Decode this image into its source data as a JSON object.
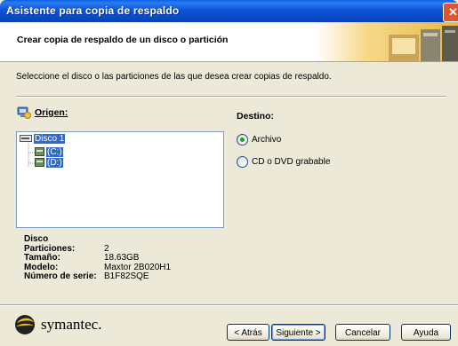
{
  "window": {
    "title": "Asistente para copia de respaldo",
    "close_glyph": "✕"
  },
  "header": {
    "heading": "Crear copia de respaldo de un disco o partición"
  },
  "instruction": "Seleccione el disco o las particiones de las que desea crear copias de respaldo.",
  "source": {
    "label": "Origen:",
    "tree": [
      {
        "label": "Disco 1"
      },
      {
        "label": "(C:)"
      },
      {
        "label": "(D:)"
      }
    ]
  },
  "destination": {
    "label": "Destino:",
    "options": [
      {
        "label": "Archivo",
        "checked": true
      },
      {
        "label": "CD o DVD grabable",
        "checked": false
      }
    ]
  },
  "disk_info": {
    "title": "Disco",
    "rows": [
      {
        "key": "Particiones:",
        "value": "2"
      },
      {
        "key": "Tamaño:",
        "value": "18.63GB"
      },
      {
        "key": "Modelo:",
        "value": "Maxtor 2B020H1"
      },
      {
        "key": "Número de serie:",
        "value": "B1F82SQE"
      }
    ]
  },
  "brand": {
    "name": "symantec."
  },
  "buttons": {
    "back": "< Atrás",
    "next": "Siguiente >",
    "cancel": "Cancelar",
    "help": "Ayuda"
  }
}
